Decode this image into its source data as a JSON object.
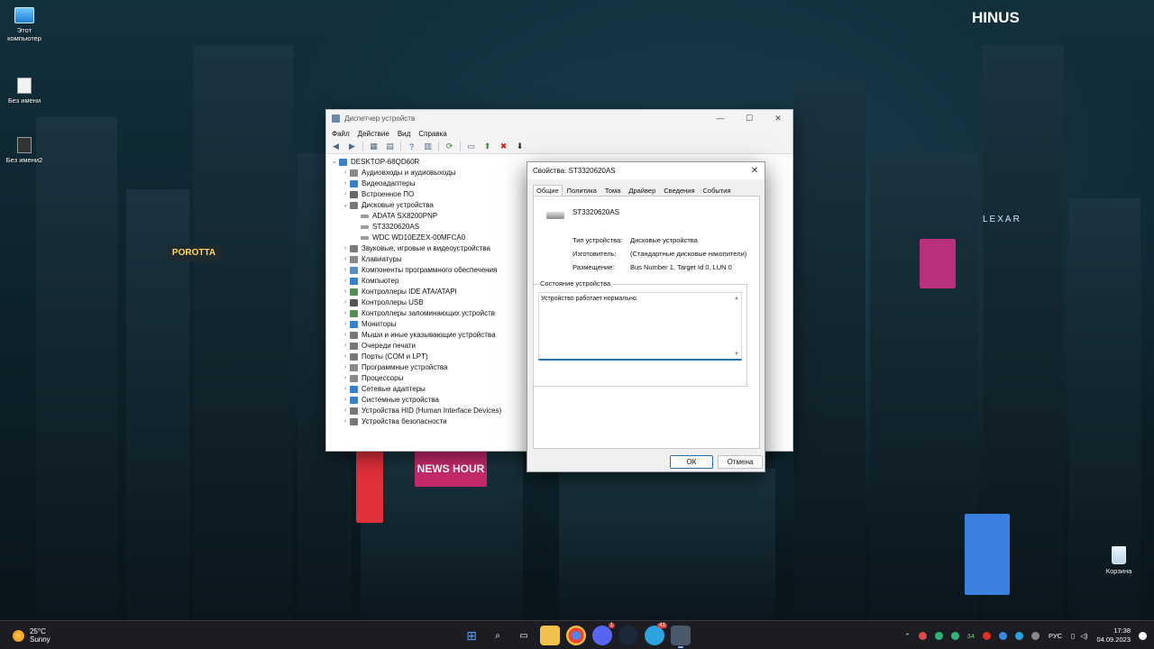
{
  "desktop": {
    "icons": [
      {
        "label": "Этот компьютер"
      },
      {
        "label": "Без имени"
      },
      {
        "label": "Без имени2"
      },
      {
        "label": "Корзина"
      }
    ],
    "wallpaper_signs": [
      "HINUS",
      "POROTTA",
      "NEWS HOUR",
      "LEXAR"
    ]
  },
  "device_manager": {
    "title": "Диспетчер устройств",
    "window_buttons": [
      "—",
      "☐",
      "✕"
    ],
    "menu": [
      "Файл",
      "Действие",
      "Вид",
      "Справка"
    ],
    "tree": {
      "root": "DESKTOP-68QD60R",
      "nodes": [
        {
          "label": "Аудиовходы и аудиовыходы",
          "expanded": false,
          "color": "#8a8a8a"
        },
        {
          "label": "Видеоадаптеры",
          "expanded": false,
          "color": "#3b7fc4"
        },
        {
          "label": "Встроенное ПО",
          "expanded": false,
          "color": "#666666"
        },
        {
          "label": "Дисковые устройства",
          "expanded": true,
          "color": "#777777",
          "children": [
            "ADATA SX8200PNP",
            "ST3320620AS",
            "WDC WD10EZEX-00MFCA0"
          ]
        },
        {
          "label": "Звуковые, игровые и видеоустройства",
          "expanded": false,
          "color": "#7a7a7a"
        },
        {
          "label": "Клавиатуры",
          "expanded": false,
          "color": "#8a8a8a"
        },
        {
          "label": "Компоненты программного обеспечения",
          "expanded": false,
          "color": "#5b8db8"
        },
        {
          "label": "Компьютер",
          "expanded": false,
          "color": "#3b7fc4"
        },
        {
          "label": "Контроллеры IDE ATA/ATAPI",
          "expanded": false,
          "color": "#5a8a5a"
        },
        {
          "label": "Контроллеры USB",
          "expanded": false,
          "color": "#555555"
        },
        {
          "label": "Контроллеры запоминающих устройств",
          "expanded": false,
          "color": "#5a8a5a"
        },
        {
          "label": "Мониторы",
          "expanded": false,
          "color": "#3b7fc4"
        },
        {
          "label": "Мыши и иные указывающие устройства",
          "expanded": false,
          "color": "#777777"
        },
        {
          "label": "Очереди печати",
          "expanded": false,
          "color": "#777777"
        },
        {
          "label": "Порты (COM и LPT)",
          "expanded": false,
          "color": "#777777"
        },
        {
          "label": "Программные устройства",
          "expanded": false,
          "color": "#8a8a8a"
        },
        {
          "label": "Процессоры",
          "expanded": false,
          "color": "#8a8a8a"
        },
        {
          "label": "Сетевые адаптеры",
          "expanded": false,
          "color": "#3b7fc4"
        },
        {
          "label": "Системные устройства",
          "expanded": false,
          "color": "#3b7fc4"
        },
        {
          "label": "Устройства HID (Human Interface Devices)",
          "expanded": false,
          "color": "#777777"
        },
        {
          "label": "Устройства безопасности",
          "expanded": false,
          "color": "#777777"
        }
      ]
    }
  },
  "properties_dialog": {
    "title": "Свойства: ST3320620AS",
    "tabs": [
      "Общие",
      "Политика",
      "Тома",
      "Драйвер",
      "Сведения",
      "События"
    ],
    "active_tab": "Общие",
    "device_name": "ST3320620AS",
    "props": [
      {
        "label": "Тип устройства:",
        "value": "Дисковые устройства"
      },
      {
        "label": "Изготовитель:",
        "value": "(Стандартные дисковые накопители)"
      },
      {
        "label": "Размещение:",
        "value": "Bus Number 1, Target Id 0, LUN 0"
      }
    ],
    "status_legend": "Состояние устройства",
    "status_text": "Устройство работает нормально.",
    "ok_label": "ОК",
    "cancel_label": "Отмена"
  },
  "taskbar": {
    "weather_temp": "25°C",
    "weather_desc": "Sunny",
    "badges": {
      "discord": "1",
      "telegram": "41"
    },
    "tray_count": "34",
    "lang": "РУС",
    "time": "17:38",
    "date": "04.09.2023"
  }
}
